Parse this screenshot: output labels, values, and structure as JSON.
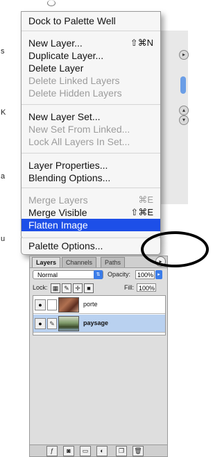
{
  "context_menu": {
    "items": [
      {
        "label": "Dock to Palette Well",
        "shortcut": "",
        "disabled": false
      },
      {
        "label": "New Layer...",
        "shortcut": "⇧⌘N",
        "disabled": false
      },
      {
        "label": "Duplicate Layer...",
        "shortcut": "",
        "disabled": false
      },
      {
        "label": "Delete Layer",
        "shortcut": "",
        "disabled": false
      },
      {
        "label": "Delete Linked Layers",
        "shortcut": "",
        "disabled": true
      },
      {
        "label": "Delete Hidden Layers",
        "shortcut": "",
        "disabled": true
      },
      {
        "label": "New Layer Set...",
        "shortcut": "",
        "disabled": false
      },
      {
        "label": "New Set From Linked...",
        "shortcut": "",
        "disabled": true
      },
      {
        "label": "Lock All Layers In Set...",
        "shortcut": "",
        "disabled": true
      },
      {
        "label": "Layer Properties...",
        "shortcut": "",
        "disabled": false
      },
      {
        "label": "Blending Options...",
        "shortcut": "",
        "disabled": false
      },
      {
        "label": "Merge Layers",
        "shortcut": "⌘E",
        "disabled": true
      },
      {
        "label": "Merge Visible",
        "shortcut": "⇧⌘E",
        "disabled": false
      },
      {
        "label": "Flatten Image",
        "shortcut": "",
        "disabled": false,
        "selected": true
      },
      {
        "label": "Palette Options...",
        "shortcut": "",
        "disabled": false
      }
    ]
  },
  "layers_palette": {
    "tabs": [
      "Layers",
      "Channels",
      "Paths"
    ],
    "active_tab": "Layers",
    "blend_mode": "Normal",
    "opacity_label": "Opacity:",
    "opacity_value": "100%",
    "lock_label": "Lock:",
    "fill_label": "Fill:",
    "fill_value": "100%",
    "layers": [
      {
        "name": "porte",
        "selected": false
      },
      {
        "name": "paysage",
        "selected": true
      }
    ]
  },
  "background": {
    "edge_chars": [
      "s",
      "K",
      "a",
      "u"
    ]
  },
  "colors": {
    "selection": "#1d4fe8",
    "accent_blue": "#3b7ce8",
    "layer_selected": "#b9d1f0"
  }
}
